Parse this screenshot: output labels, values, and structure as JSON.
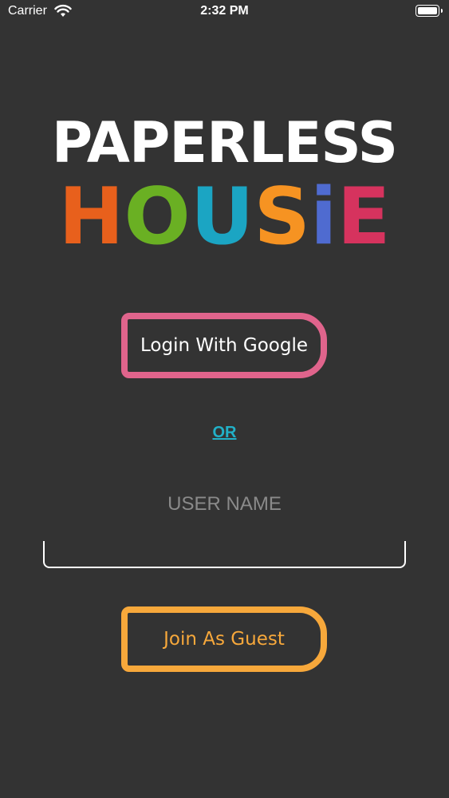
{
  "status_bar": {
    "carrier": "Carrier",
    "time": "2:32 PM",
    "battery_level": 1.0
  },
  "logo": {
    "line1": "PAPERLESS",
    "line2_letters": [
      {
        "char": "H",
        "color": "#e8601c"
      },
      {
        "char": "O",
        "color": "#6ab023"
      },
      {
        "char": "U",
        "color": "#1ba5c3"
      },
      {
        "char": "S",
        "color": "#f69322"
      },
      {
        "char": "i",
        "color": "#4f6bd0"
      },
      {
        "char": "E",
        "color": "#d6335e"
      }
    ]
  },
  "buttons": {
    "google_label": "Login With Google",
    "guest_label": "Join As Guest"
  },
  "separator": "OR",
  "username": {
    "label": "USER NAME",
    "value": ""
  },
  "colors": {
    "background": "#333333",
    "google_border": "#e0648c",
    "guest_border": "#f7a83b",
    "or_link": "#21b1c8"
  }
}
